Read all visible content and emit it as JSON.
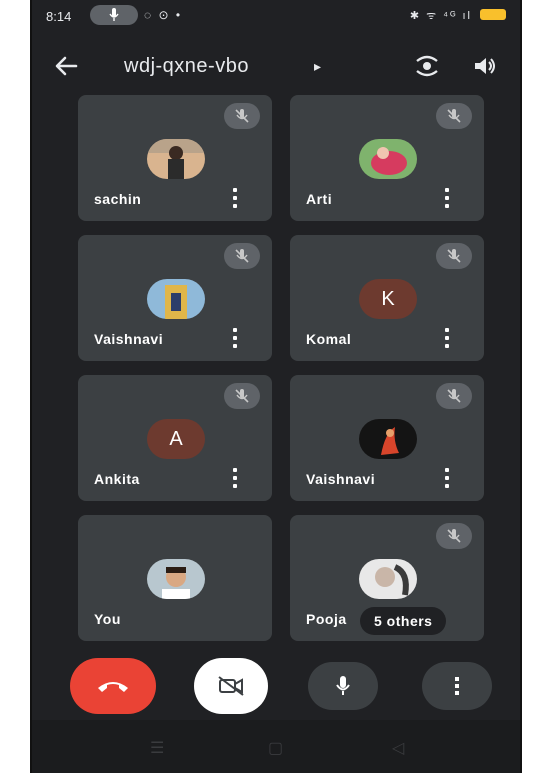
{
  "status_bar": {
    "time": "8:14",
    "left_icons": "◌ ⊙ •",
    "right_icons": "✱ ᯤ ⁴ᴳ ıl"
  },
  "header": {
    "meeting_code": "wdj-qxne-vbo",
    "caret": "▸"
  },
  "participants": [
    {
      "name": "sachin",
      "avatar_type": "photo",
      "muted": true
    },
    {
      "name": "Arti",
      "avatar_type": "photo",
      "muted": true
    },
    {
      "name": "Vaishnavi",
      "avatar_type": "photo",
      "muted": true
    },
    {
      "name": "Komal",
      "avatar_type": "letter",
      "letter": "K",
      "muted": true
    },
    {
      "name": "Ankita",
      "avatar_type": "letter",
      "letter": "A",
      "muted": true
    },
    {
      "name": "Vaishnavi",
      "avatar_type": "photo",
      "muted": true
    },
    {
      "name": "You",
      "avatar_type": "photo",
      "muted": false
    },
    {
      "name": "Pooja",
      "avatar_type": "photo",
      "muted": true,
      "others_label": "5 others"
    }
  ],
  "colors": {
    "background": "#202124",
    "tile": "#3c4043",
    "end_call": "#ea4335",
    "battery": "#f9c02c",
    "letter_avatar": "#6d3a2f"
  }
}
